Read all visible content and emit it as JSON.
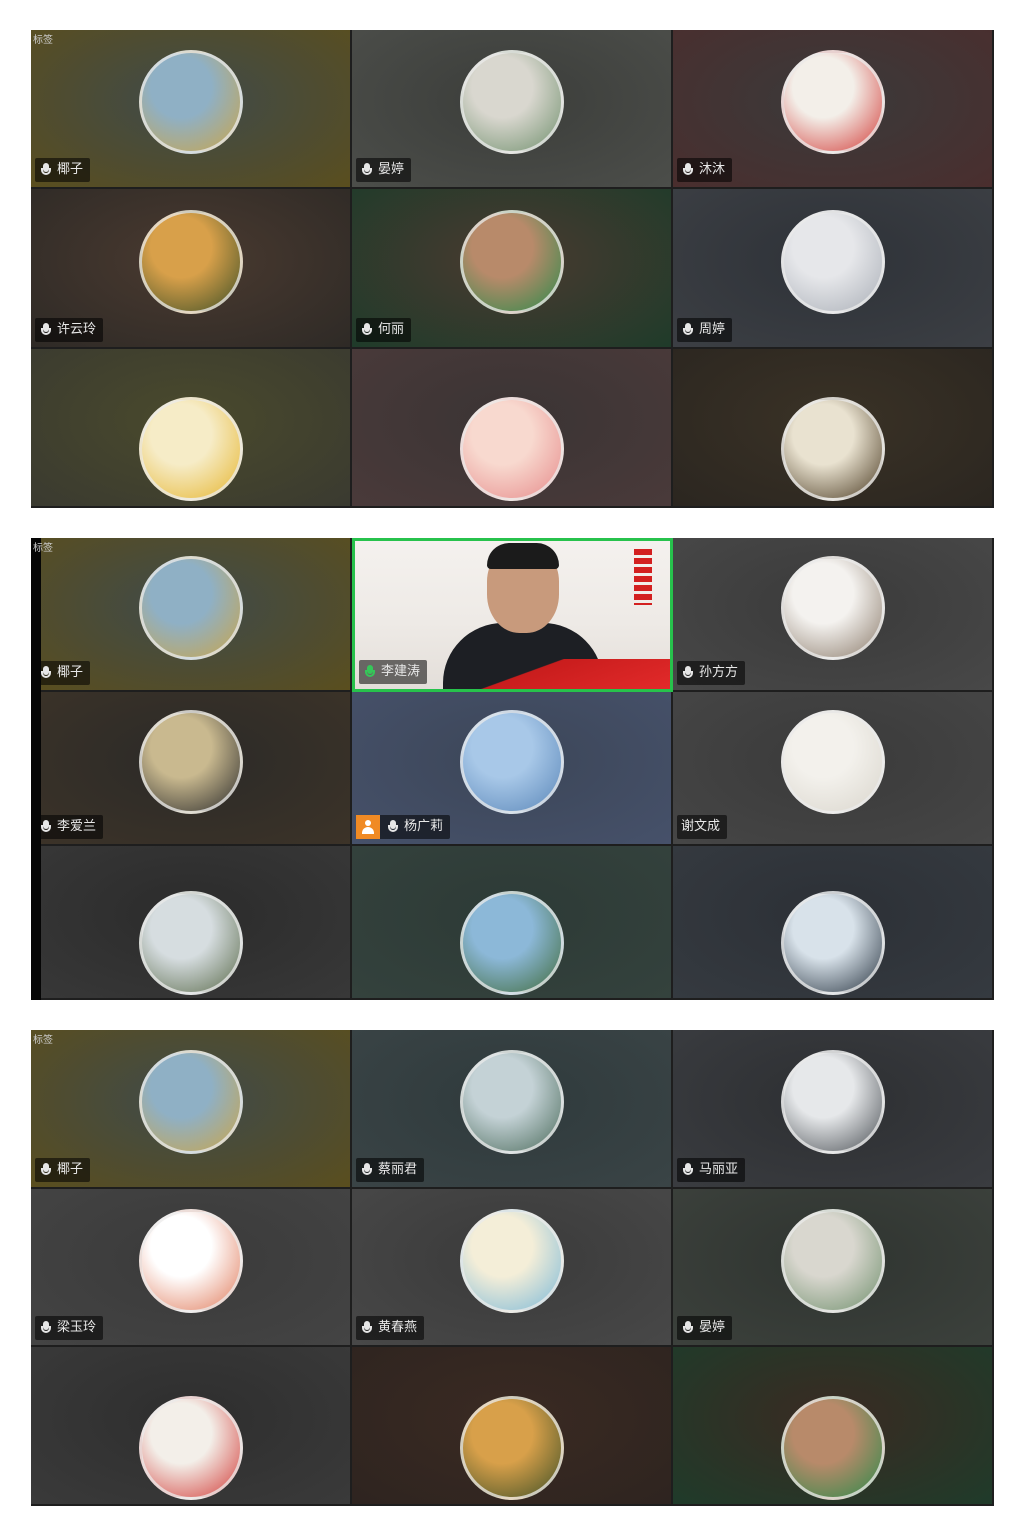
{
  "panels": [
    {
      "corner_text": "标签",
      "tiles": [
        {
          "name": "椰子",
          "avatar": "landscape-field",
          "bg": [
            "#3f4a4a",
            "#5a4e1e"
          ],
          "av": [
            "#8fb0c5",
            "#c9a54b"
          ],
          "mic": "off"
        },
        {
          "name": "晏婷",
          "avatar": "children-photo",
          "bg": [
            "#3b3d3a",
            "#4c4e4a"
          ],
          "av": [
            "#d9d7cf",
            "#6f8f6c"
          ],
          "mic": "off"
        },
        {
          "name": "沐沐",
          "avatar": "woman-portrait",
          "bg": [
            "#3a3a3a",
            "#4a2e2e"
          ],
          "av": [
            "#f3efe9",
            "#d23a36"
          ],
          "mic": "off"
        },
        {
          "name": "许云玲",
          "avatar": "sunset-field",
          "bg": [
            "#4a3a30",
            "#2e2a26"
          ],
          "av": [
            "#d8a04a",
            "#3d4f26"
          ],
          "mic": "off"
        },
        {
          "name": "何丽",
          "avatar": "man-green-shirt",
          "bg": [
            "#4a3a30",
            "#1f3b2a"
          ],
          "av": [
            "#b88a6a",
            "#2b8a4a"
          ],
          "mic": "off"
        },
        {
          "name": "周婷",
          "avatar": "baby-photo",
          "bg": [
            "#2e3238",
            "#3c3f44"
          ],
          "av": [
            "#e6e7ea",
            "#a9aeb6"
          ],
          "mic": "off"
        },
        {
          "name": "",
          "avatar": "sunflower-girl",
          "bg": [
            "#4a4a2c",
            "#3a3a30"
          ],
          "av": [
            "#f6ecc7",
            "#e6b52e"
          ],
          "mic": ""
        },
        {
          "name": "",
          "avatar": "cartoon-girl",
          "bg": [
            "#3a3434",
            "#4a3a3a"
          ],
          "av": [
            "#f8d9cf",
            "#e68a8a"
          ],
          "mic": ""
        },
        {
          "name": "",
          "avatar": "dog-photo",
          "bg": [
            "#3a3226",
            "#2b2620"
          ],
          "av": [
            "#e9e2d0",
            "#4a3a22"
          ],
          "mic": ""
        }
      ]
    },
    {
      "corner_text": "标签",
      "tiles": [
        {
          "name": "椰子",
          "avatar": "landscape-field",
          "bg": [
            "#3f4a4a",
            "#5a4e1e"
          ],
          "av": [
            "#8fb0c5",
            "#c9a54b"
          ],
          "mic": "off"
        },
        {
          "name": "李建涛",
          "avatar": "video",
          "bg": [
            "#f1eeeb",
            "#e3ded9"
          ],
          "av": [
            "#f1eeeb",
            "#e3ded9"
          ],
          "mic": "on",
          "speaking": true
        },
        {
          "name": "孙方方",
          "avatar": "flower-sketch",
          "bg": [
            "#3a3a3a",
            "#484848"
          ],
          "av": [
            "#f4f2ef",
            "#8a7a6a"
          ],
          "mic": "off"
        },
        {
          "name": "李爱兰",
          "avatar": "woman-outdoor",
          "bg": [
            "#2b2a28",
            "#3c3328"
          ],
          "av": [
            "#c9b98f",
            "#2b2b2b"
          ],
          "mic": "off"
        },
        {
          "name": "杨广莉",
          "avatar": "blue-sky",
          "bg": [
            "#3c4658",
            "#46516a"
          ],
          "av": [
            "#a8c8e8",
            "#5a86b8"
          ],
          "mic": "off",
          "host": true
        },
        {
          "name": "谢文成",
          "avatar": "child-beach",
          "bg": [
            "#3a3a3a",
            "#464646"
          ],
          "av": [
            "#f3f1ec",
            "#d9d5cc"
          ],
          "mic": ""
        },
        {
          "name": "",
          "avatar": "pavilion",
          "bg": [
            "#2b2b2b",
            "#383838"
          ],
          "av": [
            "#d6dde0",
            "#5a6a4a"
          ],
          "mic": ""
        },
        {
          "name": "",
          "avatar": "river-trees",
          "bg": [
            "#2d3a36",
            "#34423d"
          ],
          "av": [
            "#8cb8d8",
            "#3f6a3a"
          ],
          "mic": ""
        },
        {
          "name": "",
          "avatar": "highway-sky",
          "bg": [
            "#2c3036",
            "#353a40"
          ],
          "av": [
            "#d8e2ea",
            "#283440"
          ],
          "mic": ""
        }
      ]
    },
    {
      "corner_text": "标签",
      "tiles": [
        {
          "name": "椰子",
          "avatar": "landscape-field",
          "bg": [
            "#3f4a4a",
            "#5a4e1e"
          ],
          "av": [
            "#8fb0c5",
            "#c9a54b"
          ],
          "mic": "off"
        },
        {
          "name": "蔡丽君",
          "avatar": "hazy-hills",
          "bg": [
            "#2f3a3c",
            "#3a4446"
          ],
          "av": [
            "#c4d2d6",
            "#4a6a5a"
          ],
          "mic": "off"
        },
        {
          "name": "马丽亚",
          "avatar": "cloudy-sky",
          "bg": [
            "#2d2f32",
            "#3a3c40"
          ],
          "av": [
            "#e6e8ea",
            "#4a4f54"
          ],
          "mic": "off"
        },
        {
          "name": "梁玉玲",
          "avatar": "hand-flower",
          "bg": [
            "#3a3a3a",
            "#444444"
          ],
          "av": [
            "#ffffff",
            "#e07a5a"
          ],
          "mic": "off"
        },
        {
          "name": "黄春燕",
          "avatar": "girl-hat",
          "bg": [
            "#3a3a3a",
            "#484848"
          ],
          "av": [
            "#f4eed8",
            "#7ab8d8"
          ],
          "mic": "off"
        },
        {
          "name": "晏婷",
          "avatar": "children-photo",
          "bg": [
            "#2f3430",
            "#3c413c"
          ],
          "av": [
            "#d9d7cf",
            "#6f8f6c"
          ],
          "mic": "off"
        },
        {
          "name": "",
          "avatar": "woman-portrait",
          "bg": [
            "#2e2e2e",
            "#3a3a3a"
          ],
          "av": [
            "#f3efe9",
            "#d23a36"
          ],
          "mic": ""
        },
        {
          "name": "",
          "avatar": "sunset-field",
          "bg": [
            "#3a2a22",
            "#2e2420"
          ],
          "av": [
            "#d8a04a",
            "#3d4f26"
          ],
          "mic": ""
        },
        {
          "name": "",
          "avatar": "man-green-shirt",
          "bg": [
            "#3a2a22",
            "#1f3b2a"
          ],
          "av": [
            "#b88a6a",
            "#2b8a4a"
          ],
          "mic": ""
        }
      ]
    }
  ]
}
